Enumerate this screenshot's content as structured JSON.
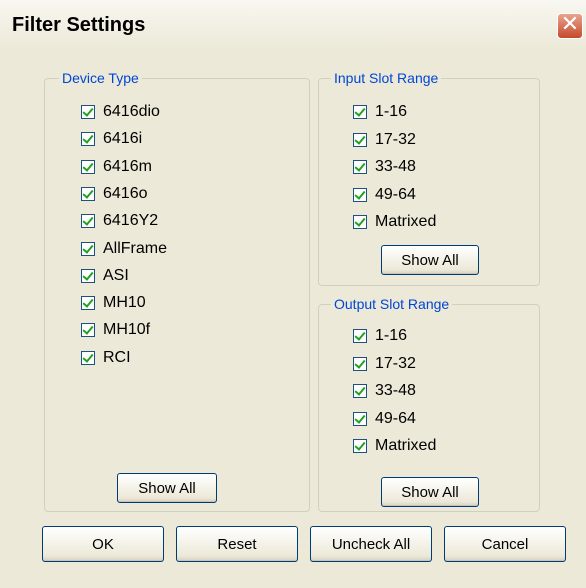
{
  "window": {
    "title": "Filter Settings",
    "close_glyph": "✕"
  },
  "device_type": {
    "label": "Device Type",
    "items": [
      {
        "label": "6416dio",
        "checked": true
      },
      {
        "label": "6416i",
        "checked": true
      },
      {
        "label": "6416m",
        "checked": true
      },
      {
        "label": "6416o",
        "checked": true
      },
      {
        "label": "6416Y2",
        "checked": true
      },
      {
        "label": "AllFrame",
        "checked": true
      },
      {
        "label": "ASI",
        "checked": true
      },
      {
        "label": "MH10",
        "checked": true
      },
      {
        "label": "MH10f",
        "checked": true
      },
      {
        "label": "RCI",
        "checked": true
      }
    ],
    "show_all_label": "Show All"
  },
  "input_slot_range": {
    "label": "Input Slot Range",
    "items": [
      {
        "label": "1-16",
        "checked": true
      },
      {
        "label": "17-32",
        "checked": true
      },
      {
        "label": "33-48",
        "checked": true
      },
      {
        "label": "49-64",
        "checked": true
      },
      {
        "label": "Matrixed",
        "checked": true
      }
    ],
    "show_all_label": "Show All"
  },
  "output_slot_range": {
    "label": "Output Slot Range",
    "items": [
      {
        "label": "1-16",
        "checked": true
      },
      {
        "label": "17-32",
        "checked": true
      },
      {
        "label": "33-48",
        "checked": true
      },
      {
        "label": "49-64",
        "checked": true
      },
      {
        "label": "Matrixed",
        "checked": true
      }
    ],
    "show_all_label": "Show All"
  },
  "buttons": {
    "ok": "OK",
    "reset": "Reset",
    "uncheck_all": "Uncheck All",
    "cancel": "Cancel"
  },
  "colors": {
    "legend": "#0046d5",
    "check": "#21a121",
    "close": "#c64a2b"
  }
}
